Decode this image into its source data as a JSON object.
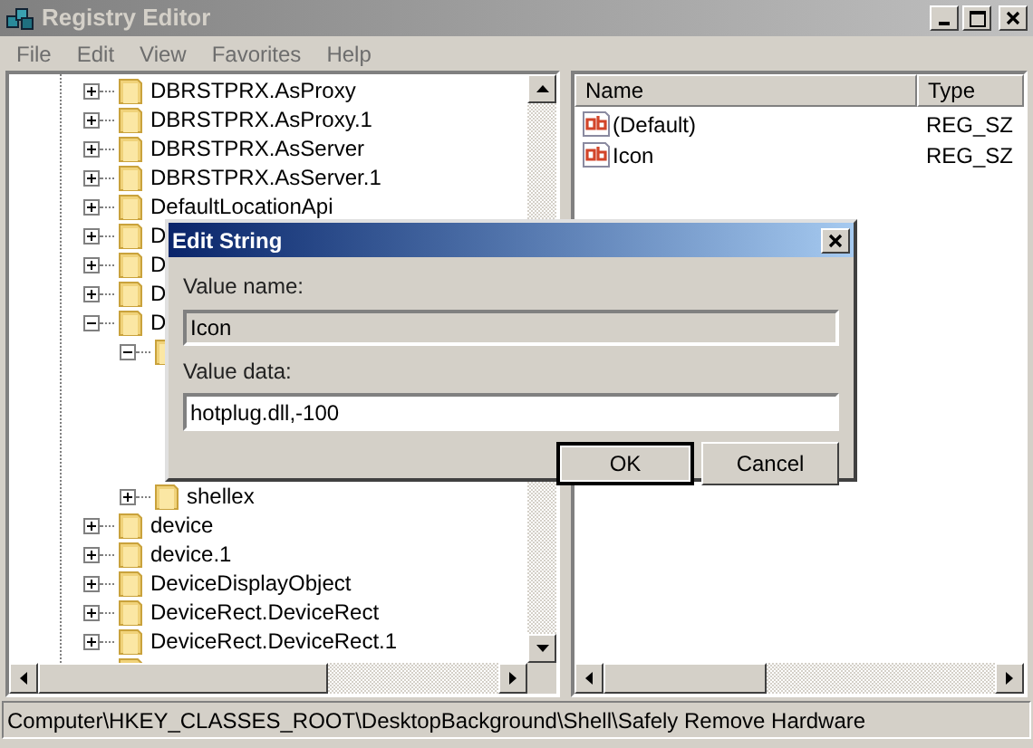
{
  "window": {
    "title": "Registry Editor",
    "active": false
  },
  "menu": [
    "File",
    "Edit",
    "View",
    "Favorites",
    "Help"
  ],
  "tree": [
    {
      "label": "DBRSTPRX.AsProxy",
      "expanded": false
    },
    {
      "label": "DBRSTPRX.AsProxy.1",
      "expanded": false
    },
    {
      "label": "DBRSTPRX.AsServer",
      "expanded": false
    },
    {
      "label": "DBRSTPRX.AsServer.1",
      "expanded": false
    },
    {
      "label": "DefaultLocationApi",
      "expanded": false
    },
    {
      "label": "D",
      "expanded": false
    },
    {
      "label": "D",
      "expanded": false
    },
    {
      "label": "D",
      "expanded": false
    },
    {
      "label": "D",
      "expanded": true,
      "children": [
        {
          "expanded": true
        },
        {
          "label": "shellex",
          "expanded": false
        }
      ]
    },
    {
      "label": "device",
      "expanded": false
    },
    {
      "label": "device.1",
      "expanded": false
    },
    {
      "label": "DeviceDisplayObject",
      "expanded": false
    },
    {
      "label": "DeviceRect.DeviceRect",
      "expanded": false
    },
    {
      "label": "DeviceRect.DeviceRect.1",
      "expanded": false
    },
    {
      "expanded": false
    }
  ],
  "values": {
    "columns": [
      "Name",
      "Type"
    ],
    "rows": [
      {
        "name": "(Default)",
        "type": "REG_SZ"
      },
      {
        "name": "Icon",
        "type": "REG_SZ"
      }
    ]
  },
  "dialog": {
    "title": "Edit String",
    "name_label": "Value name:",
    "name_value": "Icon",
    "data_label": "Value data:",
    "data_value": "hotplug.dll,-100",
    "buttons": [
      {
        "label": "OK",
        "default": true
      },
      {
        "label": "Cancel",
        "default": false
      }
    ]
  },
  "status_bar": "Computer\\HKEY_CLASSES_ROOT\\DesktopBackground\\Shell\\Safely Remove Hardware"
}
